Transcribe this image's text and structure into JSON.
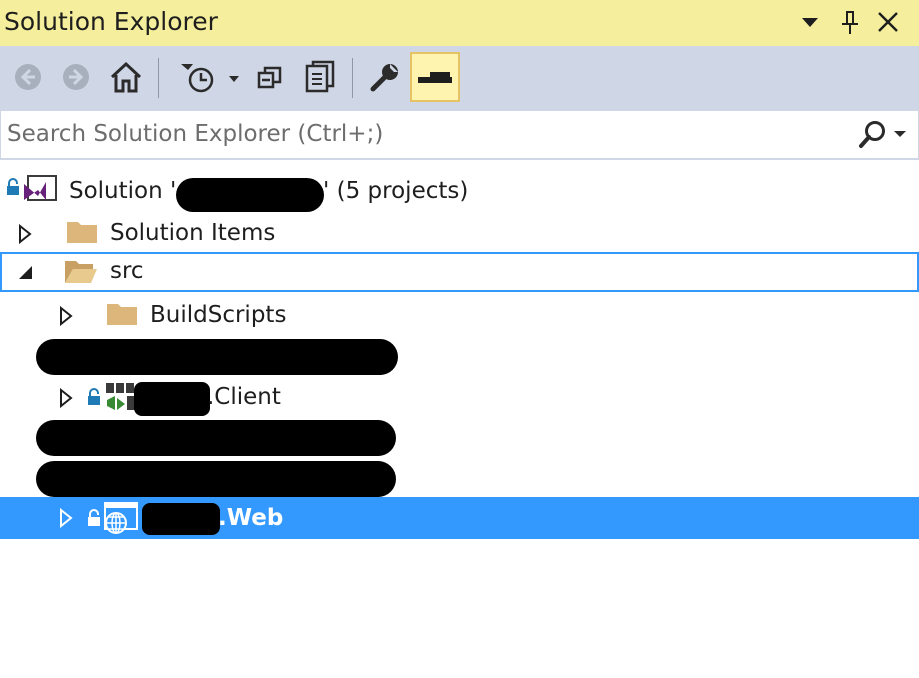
{
  "window": {
    "title": "Solution Explorer",
    "controls": [
      "dropdown-icon",
      "pin-icon",
      "close-icon"
    ]
  },
  "toolbar": {
    "buttons": [
      "back-icon",
      "forward-icon",
      "home-icon",
      "pending-changes-filter-icon",
      "collapse-all-icon",
      "show-all-files-icon",
      "properties-icon",
      "preview-selected-items-icon"
    ]
  },
  "search": {
    "placeholder": "Search Solution Explorer (Ctrl+;)"
  },
  "tree": {
    "solution_prefix": "Solution '",
    "solution_suffix": "' (5 projects)",
    "items": [
      {
        "label": "Solution Items",
        "expanded": false,
        "type": "folder"
      },
      {
        "label": "src",
        "expanded": true,
        "type": "folder"
      },
      {
        "label": "BuildScripts",
        "expanded": false,
        "type": "folder"
      },
      {
        "label": ".Client",
        "expanded": false,
        "type": "project"
      },
      {
        "label": ".Web",
        "expanded": false,
        "type": "web-project",
        "selected": true
      }
    ]
  },
  "colors": {
    "title_bar": "#f5ee9c",
    "toolbar": "#cfd6e5",
    "selection": "#3399ff",
    "folder": "#dcb67a"
  }
}
